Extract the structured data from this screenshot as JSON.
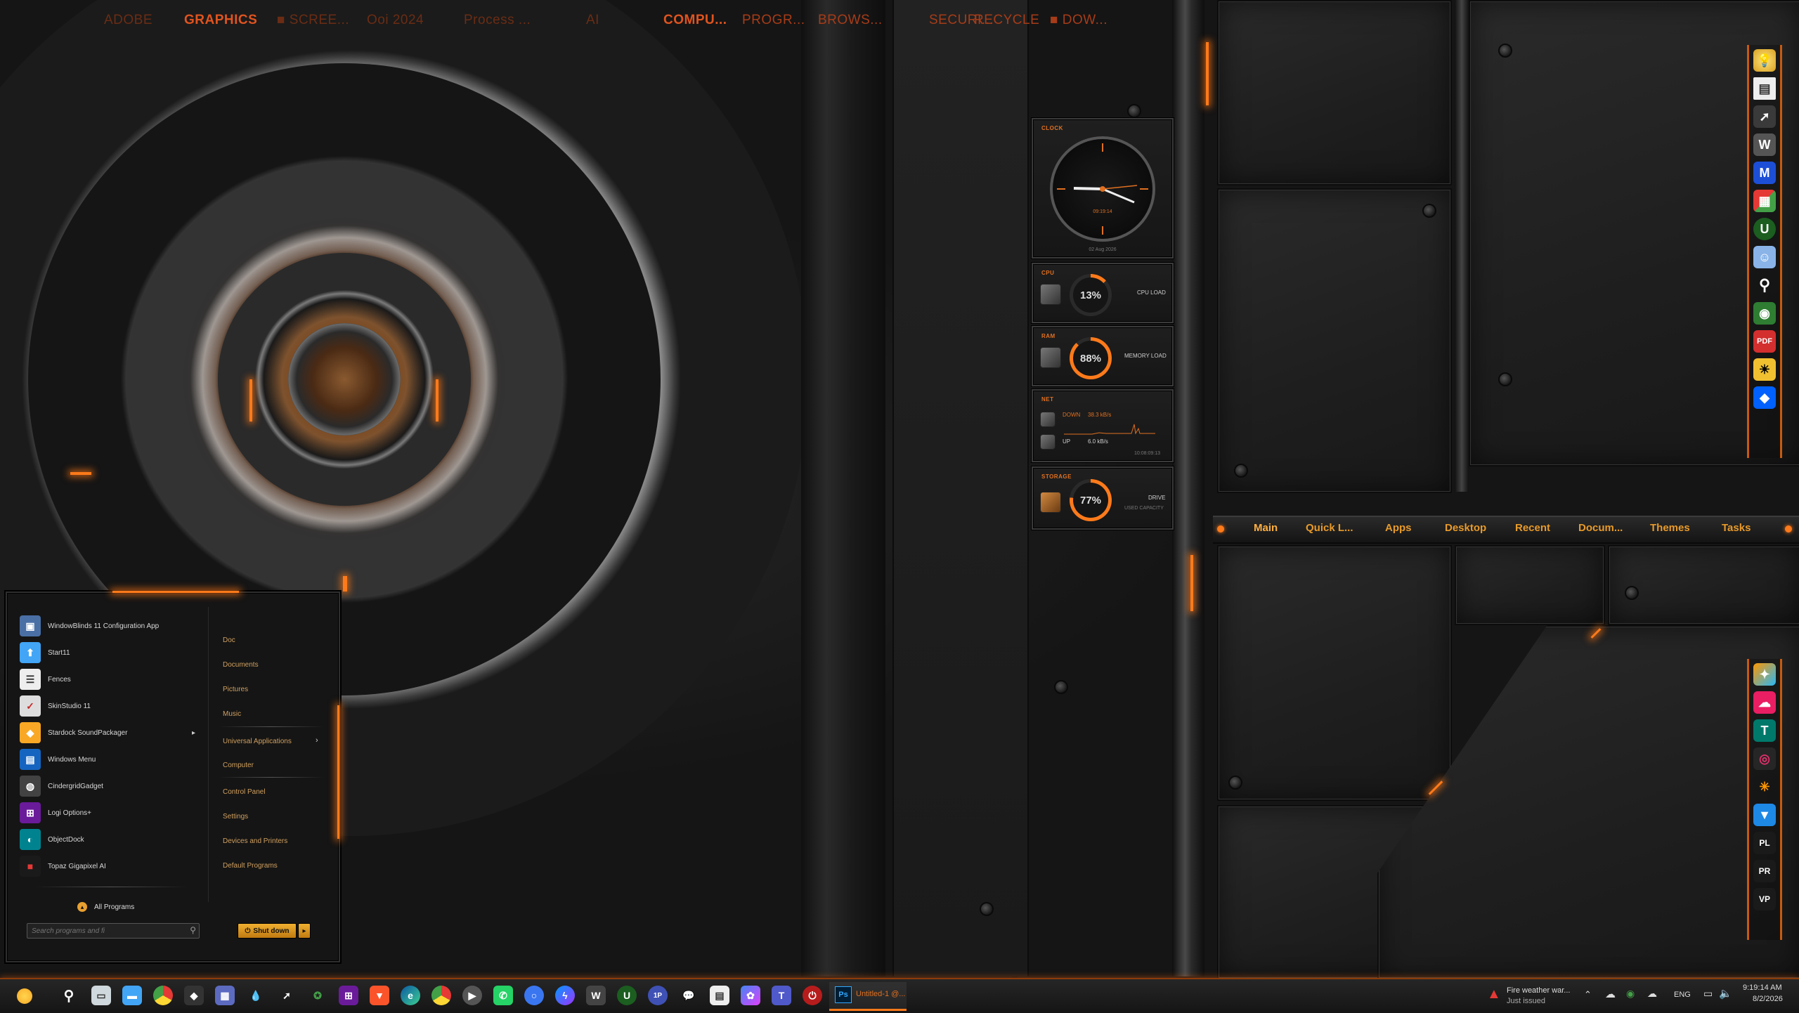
{
  "topbar": {
    "left_items": [
      "ADOBE",
      "GRAPHICS",
      "SCREE...",
      "Ooi 2024",
      "Process ...",
      "AI"
    ],
    "right_items": [
      "COMPU...",
      "PROGR...",
      "BROWS...",
      "SECURI...",
      "RECYCLE",
      "DOW..."
    ]
  },
  "gadgets": {
    "clock": {
      "title": "CLOCK",
      "time": "09:19:14",
      "date": "02 Aug 2026"
    },
    "cpu": {
      "title": "CPU",
      "value": "13%",
      "label": "CPU LOAD",
      "fraction": 0.13
    },
    "ram": {
      "title": "RAM",
      "value": "88%",
      "label": "MEMORY LOAD",
      "fraction": 0.88
    },
    "net": {
      "title": "NET",
      "down_label": "DOWN",
      "down_value": "38.3 kB/s",
      "up_label": "UP",
      "up_value": "6.0 kB/s",
      "footer": "10:08:09:13"
    },
    "storage": {
      "title": "STORAGE",
      "value": "77%",
      "label": "DRIVE",
      "sub": "USED CAPACITY",
      "fraction": 0.77
    }
  },
  "tabbar": {
    "tabs": [
      "Main",
      "Quick L...",
      "Apps",
      "Desktop",
      "Recent",
      "Docum...",
      "Themes",
      "Tasks"
    ]
  },
  "start_menu": {
    "programs": [
      "WindowBlinds 11 Configuration App",
      "Start11",
      "Fences",
      "SkinStudio 11",
      "Stardock SoundPackager",
      "Windows Menu",
      "CindergridGadget",
      "Logi Options+",
      "ObjectDock",
      "Topaz Gigapixel AI"
    ],
    "all_programs": "All Programs",
    "right_items": [
      "Doc",
      "Documents",
      "Pictures",
      "Music",
      "Universal Applications",
      "Computer",
      "Control Panel",
      "Settings",
      "Devices and Printers",
      "Default Programs"
    ],
    "search_placeholder": "Search programs and fi",
    "shutdown": "Shut down"
  },
  "taskbar": {
    "active_app": "Untitled-1 @...",
    "notification_title": "Fire weather war...",
    "notification_sub": "Just issued",
    "language": "ENG",
    "time": "9:19:14 AM",
    "date": "8/2/2026"
  },
  "colors": {
    "accent": "#ff7a1a",
    "text_orange": "#e0541f",
    "tab_text": "#e89a2a"
  }
}
